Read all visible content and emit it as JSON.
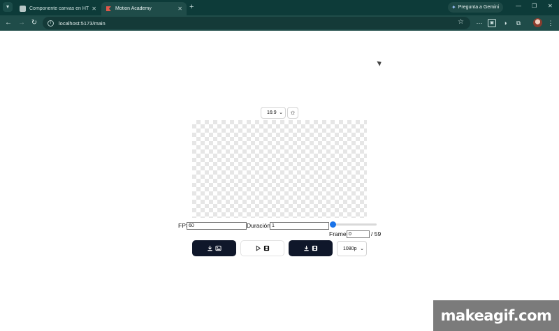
{
  "browser": {
    "tabs": [
      {
        "title": "Componente canvas en HTML",
        "active": false
      },
      {
        "title": "Motion Academy",
        "active": true
      }
    ],
    "new_tab": "+",
    "gemini_label": "Pregunta a Gemini",
    "address": "localhost:5173/main"
  },
  "editor": {
    "aspect_ratio": "16:9",
    "fps_label": "FPS",
    "fps_value": "60",
    "duration_label": "Duración",
    "duration_value": "1",
    "frame_slider_value": 0,
    "frame_label": "Frame",
    "frame_value": "0",
    "frame_total": "/ 59",
    "resolution": "1080p"
  },
  "watermark": "makeagif.com",
  "colors": {
    "tab_bar": "#0d3b39",
    "toolbar": "#1f4c49",
    "button_dark": "#0f172a",
    "slider_accent": "#1a73e8"
  },
  "icons": {
    "download_image": "download-image-icon",
    "play_video": "play-video-icon",
    "download_video": "download-video-icon",
    "theme": "sun-icon"
  }
}
